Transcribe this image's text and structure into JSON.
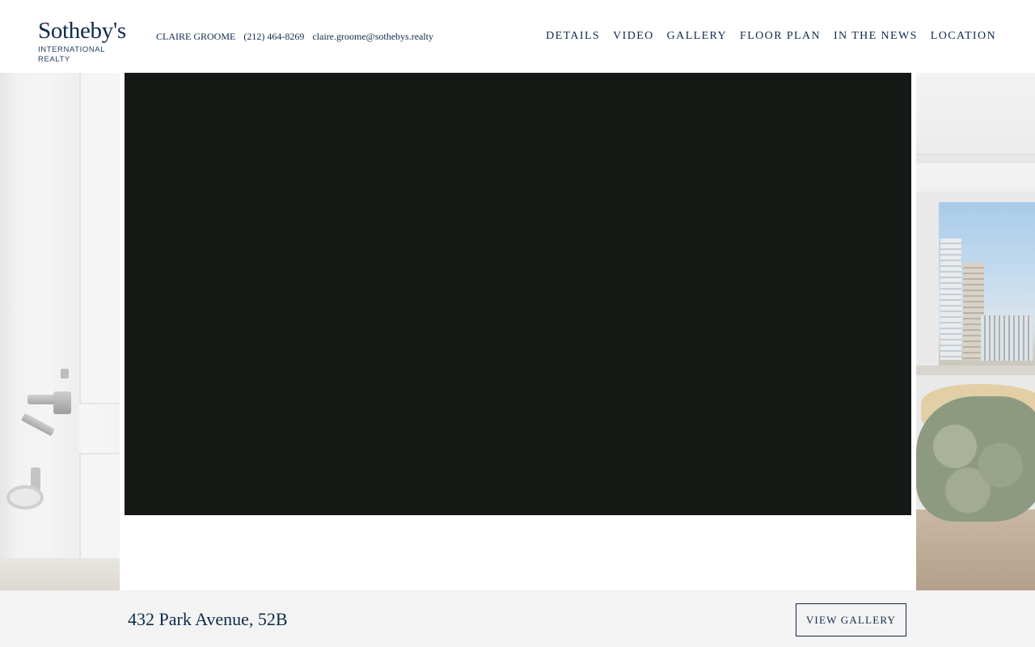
{
  "brand": {
    "name": "Sotheby's",
    "subline": "INTERNATIONAL REALTY"
  },
  "agent": {
    "name": "CLAIRE GROOME",
    "phone": "(212) 464-8269",
    "email": "claire.groome@sothebys.realty"
  },
  "nav": {
    "items": [
      {
        "label": "DETAILS"
      },
      {
        "label": "VIDEO"
      },
      {
        "label": "GALLERY"
      },
      {
        "label": "FLOOR PLAN"
      },
      {
        "label": "IN THE NEWS"
      },
      {
        "label": "LOCATION"
      }
    ]
  },
  "listing": {
    "address": "432 Park Avenue, 52B",
    "gallery_button": "VIEW GALLERY"
  },
  "colors": {
    "brand_navy": "#0f2a4a",
    "video_background": "#161a17",
    "footer_background": "#f3f3f3"
  }
}
